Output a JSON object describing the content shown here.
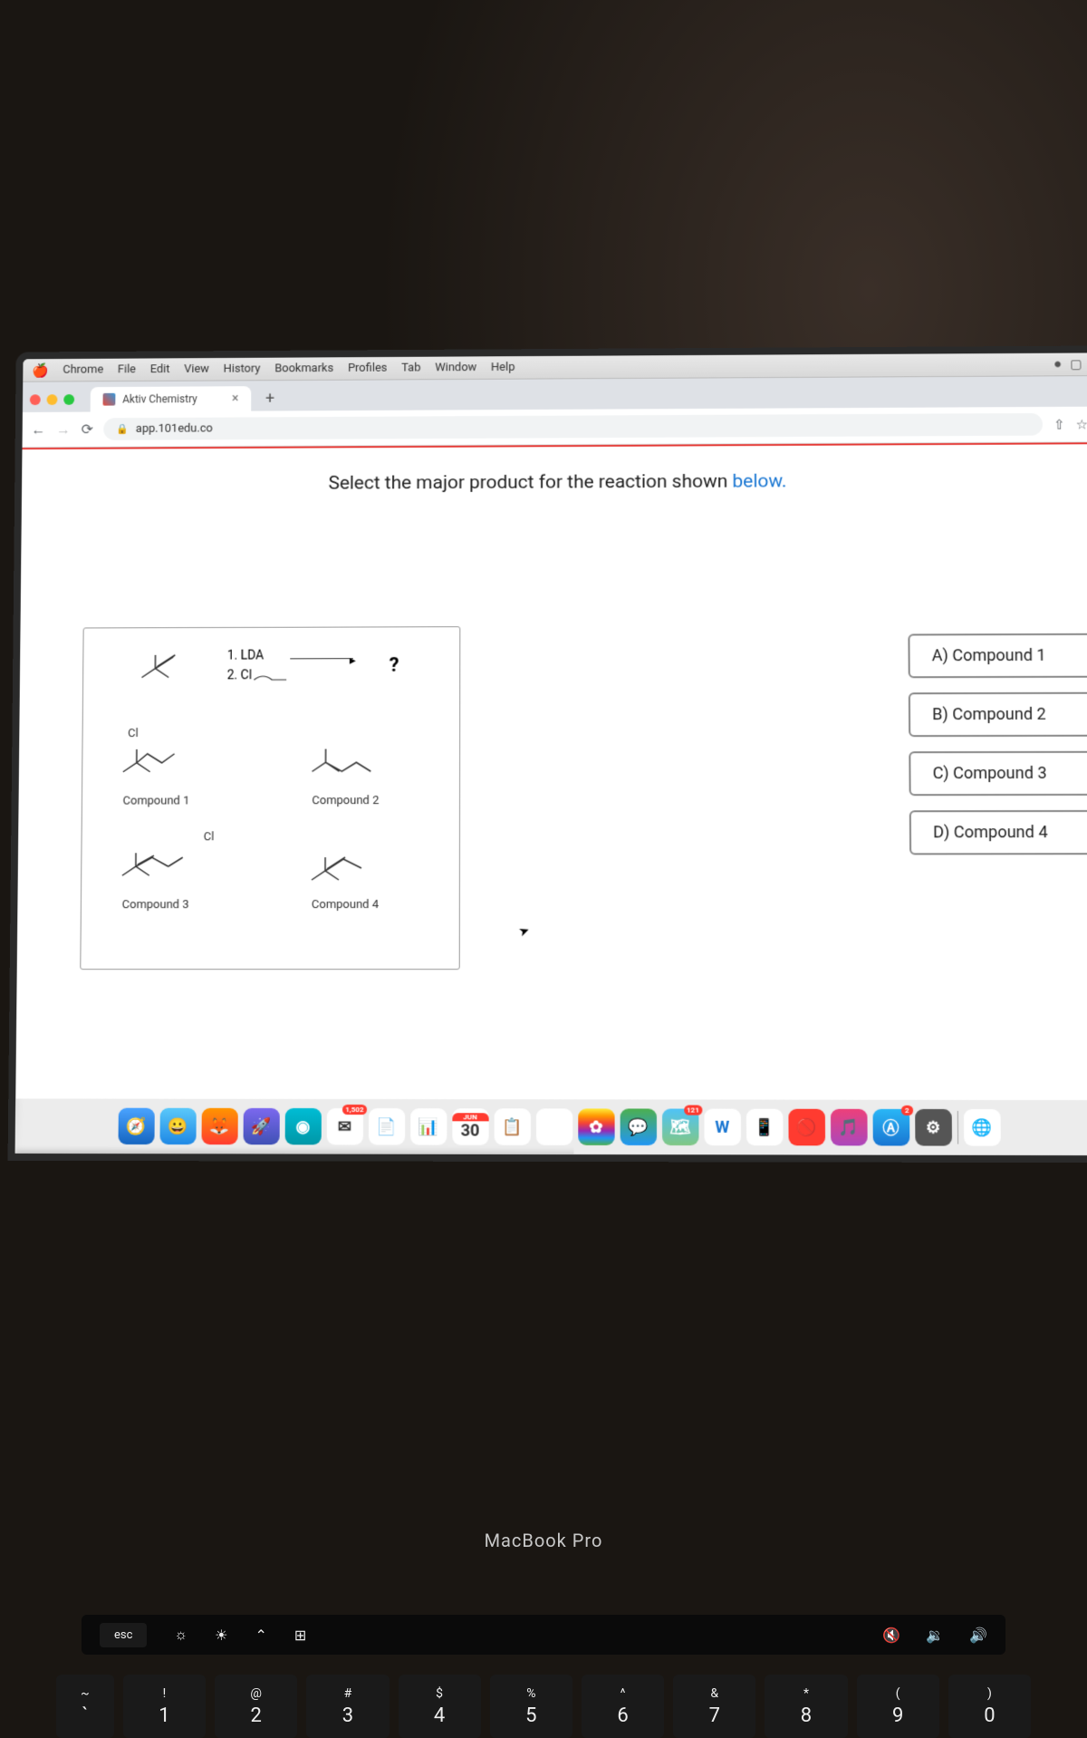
{
  "menubar": {
    "items": [
      "Chrome",
      "File",
      "Edit",
      "View",
      "History",
      "Bookmarks",
      "Profiles",
      "Tab",
      "Window",
      "Help"
    ]
  },
  "tab": {
    "title": "Aktiv Chemistry"
  },
  "url": "app.101edu.co",
  "question_text": "Select the major product for the reaction shown ",
  "question_link": "below.",
  "reagents": {
    "step1": "1. LDA",
    "step2": "2. Cl",
    "q": "?"
  },
  "compounds": {
    "c1": "Compound 1",
    "c2": "Compound 2",
    "c3": "Compound 3",
    "c4": "Compound 4",
    "cl_top": "Cl",
    "cl_mid": "Cl"
  },
  "answers": {
    "a": "A) Compound 1",
    "b": "B) Compound 2",
    "c": "C) Compound 3",
    "d": "D) Compound 4"
  },
  "dock": {
    "calendar_month": "JUN",
    "calendar_day": "30",
    "mail_badge": "1,502",
    "w": "W",
    "store_badge": "2",
    "maps_badge": "121"
  },
  "deck": {
    "label": "MacBook Pro",
    "esc": "esc"
  },
  "keys": [
    {
      "top": "~",
      "bot": "`"
    },
    {
      "top": "!",
      "bot": "1"
    },
    {
      "top": "@",
      "bot": "2"
    },
    {
      "top": "#",
      "bot": "3"
    },
    {
      "top": "$",
      "bot": "4"
    },
    {
      "top": "%",
      "bot": "5"
    },
    {
      "top": "^",
      "bot": "6"
    },
    {
      "top": "&",
      "bot": "7"
    },
    {
      "top": "*",
      "bot": "8"
    },
    {
      "top": "(",
      "bot": "9"
    },
    {
      "top": ")",
      "bot": "0"
    }
  ]
}
